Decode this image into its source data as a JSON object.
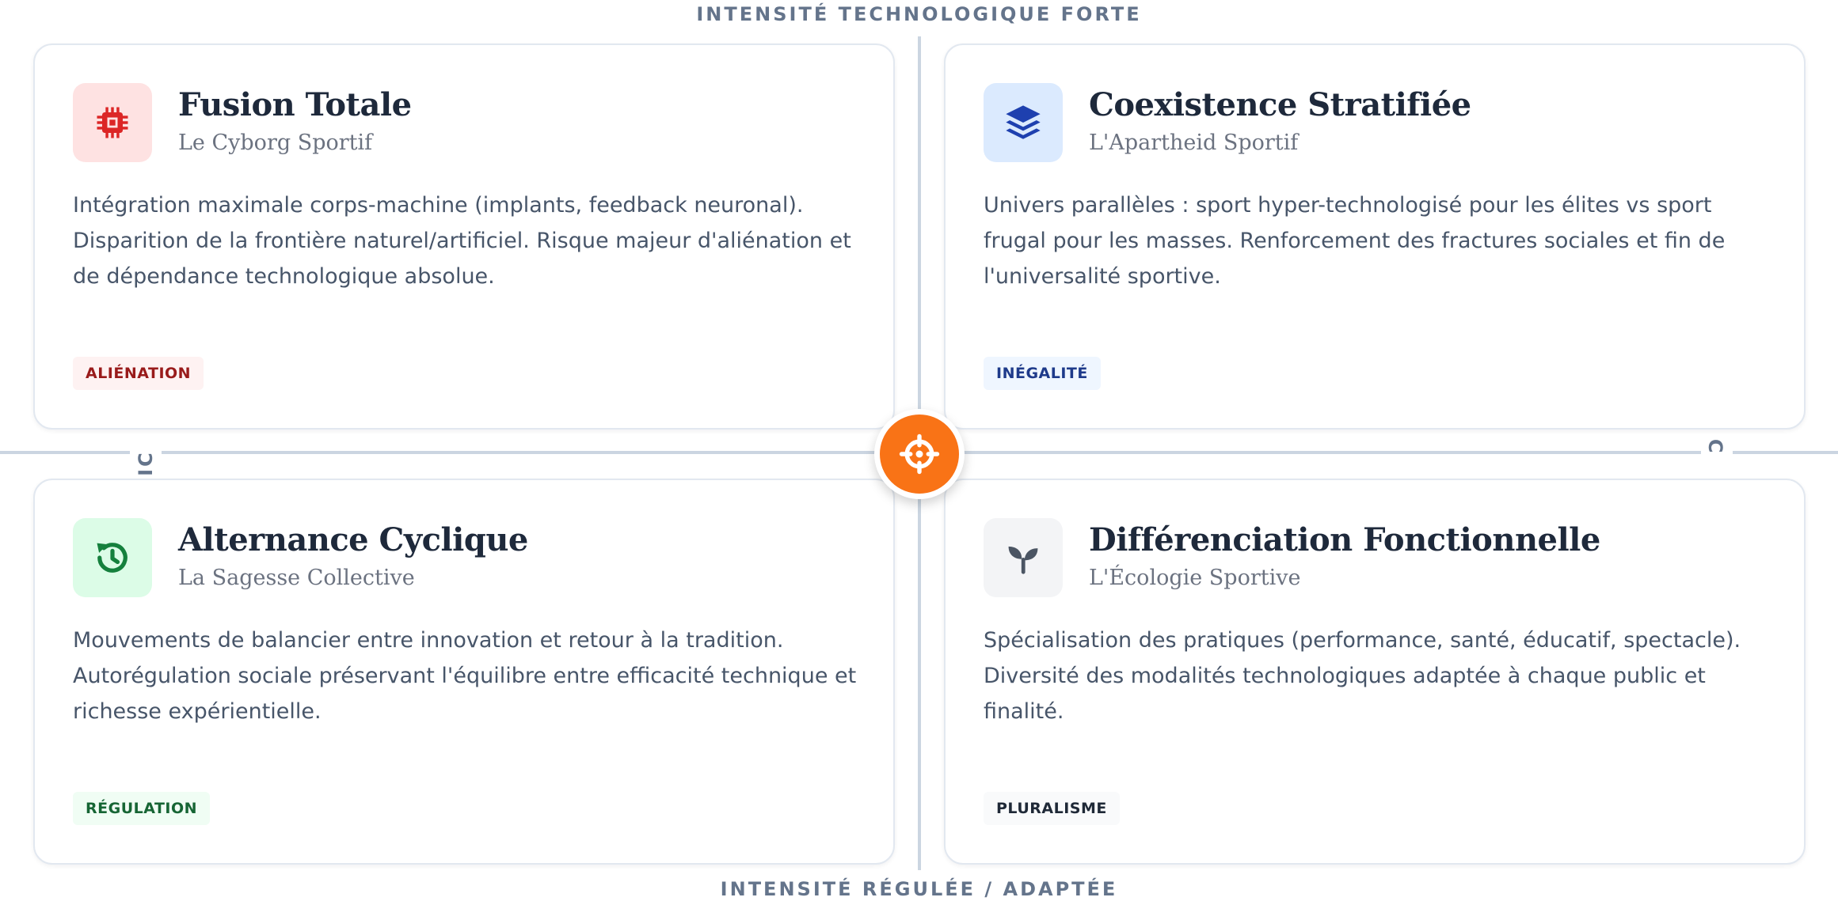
{
  "axes": {
    "top": "INTENSITÉ TECHNOLOGIQUE FORTE",
    "bottom": "INTENSITÉ RÉGULÉE / ADAPTÉE",
    "left": "ATIC",
    "right": "É / C"
  },
  "center": {
    "icon": "crosshair-icon",
    "color": "#f97316"
  },
  "quadrants": [
    {
      "title": "Fusion Totale",
      "subtitle": "Le Cyborg Sportif",
      "description": "Intégration maximale corps-machine (implants, feedback neuronal). Disparition de la frontière naturel/artificiel. Risque majeur d'aliénation et de dépendance technologique absolue.",
      "badge": "ALIÉNATION",
      "icon": "microchip-icon",
      "icon_color": "#dc2626",
      "icon_bg": "#fee2e2",
      "badge_color": "#991b1b",
      "badge_bg": "#fef2f2"
    },
    {
      "title": "Coexistence Stratifiée",
      "subtitle": "L'Apartheid Sportif",
      "description": "Univers parallèles : sport hyper-technologisé pour les élites vs sport frugal pour les masses. Renforcement des fractures sociales et fin de l'universalité sportive.",
      "badge": "INÉGALITÉ",
      "icon": "layers-icon",
      "icon_color": "#1e40af",
      "icon_bg": "#dbeafe",
      "badge_color": "#1e3a8a",
      "badge_bg": "#eff6ff"
    },
    {
      "title": "Alternance Cyclique",
      "subtitle": "La Sagesse Collective",
      "description": "Mouvements de balancier entre innovation et retour à la tradition. Autorégulation sociale préservant l'équilibre entre efficacité technique et richesse expérientielle.",
      "badge": "RÉGULATION",
      "icon": "history-icon",
      "icon_color": "#15803d",
      "icon_bg": "#dcfce7",
      "badge_color": "#166534",
      "badge_bg": "#f0fdf4"
    },
    {
      "title": "Différenciation Fonctionnelle",
      "subtitle": "L'Écologie Sportive",
      "description": "Spécialisation des pratiques (performance, santé, éducatif, spectacle). Diversité des modalités technologiques adaptée à chaque public et finalité.",
      "badge": "PLURALISME",
      "icon": "seedling-icon",
      "icon_color": "#4b5563",
      "icon_bg": "#f3f4f6",
      "badge_color": "#1f2937",
      "badge_bg": "#f9fafb"
    }
  ]
}
